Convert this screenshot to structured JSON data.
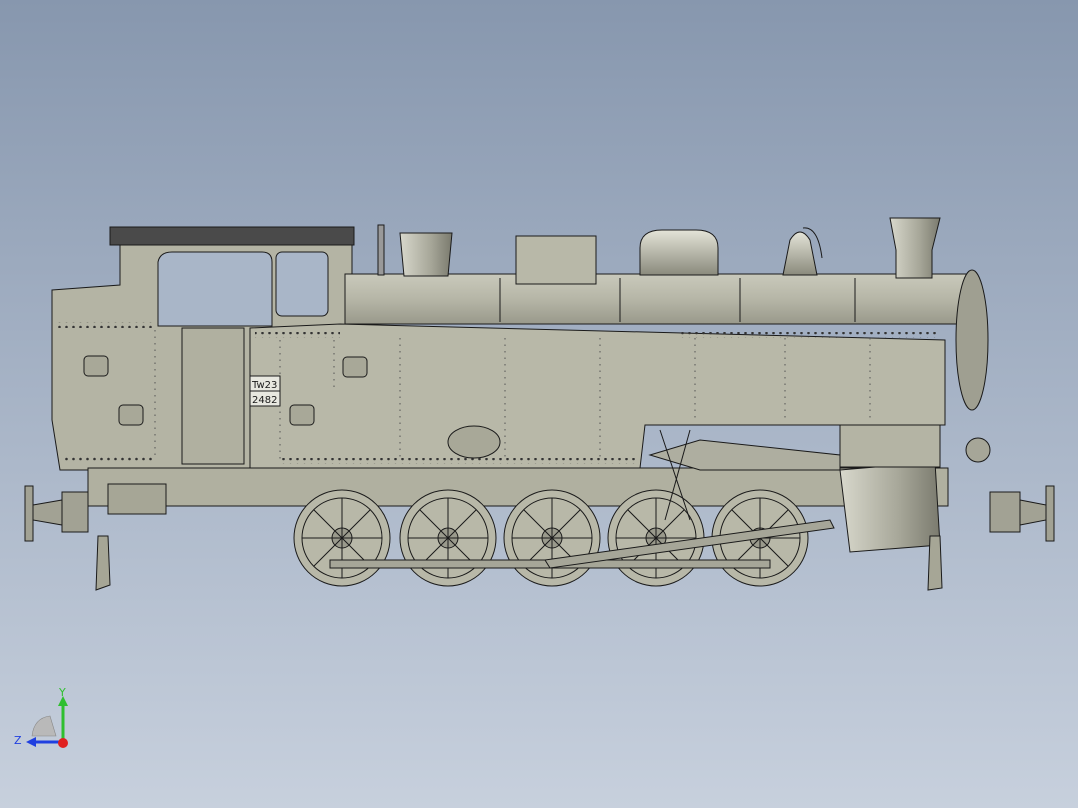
{
  "viewport": {
    "background_top": "#8797ae",
    "background_bottom": "#c7d0dd",
    "model_fill": "#b5b5a5",
    "model_line": "#1a1a1a"
  },
  "model": {
    "number_plate": {
      "line1": "Tw23",
      "line2": "2482"
    }
  },
  "triad": {
    "y_label": "Y",
    "z_label": "Z",
    "y_color": "#2fbf2f",
    "z_color": "#2040e0",
    "x_color": "#e02020",
    "icon": "view-orientation-triad-icon"
  }
}
